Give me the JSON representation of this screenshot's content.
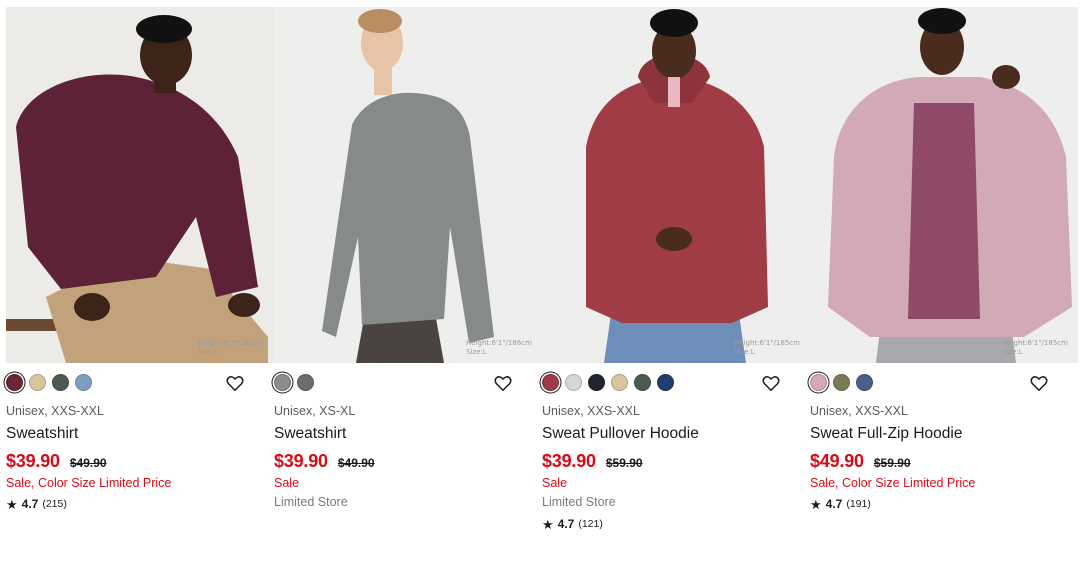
{
  "products": [
    {
      "swatches": [
        "#6b2636",
        "#d8c59f",
        "#4e5a4f",
        "#7f9ec2"
      ],
      "selected_swatch": 0,
      "gender_size": "Unisex, XXS-XXL",
      "name": "Sweatshirt",
      "price": "$39.90",
      "original_price": "$49.90",
      "flag_primary": "Sale, Color Size Limited Price",
      "flag_secondary": "",
      "rating": {
        "star": "★",
        "score": "4.7",
        "count": "(215)"
      },
      "photo": {
        "caption": [
          "Height:6'1\"/185cm",
          "Size:L"
        ],
        "garment_color": "#5d2237",
        "pants_color": "#c2a27a",
        "background": "#ecebe8"
      }
    },
    {
      "swatches": [
        "#8a8c8e",
        "#6b6c6c"
      ],
      "selected_swatch": 0,
      "gender_size": "Unisex, XS-XL",
      "name": "Sweatshirt",
      "price": "$39.90",
      "original_price": "$49.90",
      "flag_primary": "Sale",
      "flag_secondary": "Limited Store",
      "rating": null,
      "photo": {
        "caption": [
          "Height:6'1\"/186cm",
          "Size:L"
        ],
        "garment_color": "#878a8a",
        "pants_color": "#4a4341",
        "background": "#eeeeec"
      }
    },
    {
      "swatches": [
        "#9e3a45",
        "#d6d6d6",
        "#1f2430",
        "#d8c59f",
        "#4e5a4f",
        "#1f3f6e"
      ],
      "selected_swatch": 0,
      "gender_size": "Unisex, XXS-XXL",
      "name": "Sweat Pullover Hoodie",
      "price": "$39.90",
      "original_price": "$59.90",
      "flag_primary": "Sale",
      "flag_secondary": "Limited Store",
      "rating": {
        "star": "★",
        "score": "4.7",
        "count": "(121)"
      },
      "photo": {
        "caption": [
          "Height:6'1\"/185cm",
          "Size:L"
        ],
        "garment_color": "#a03c45",
        "pants_color": "#6f8db9",
        "background": "#eeeeec"
      }
    },
    {
      "swatches": [
        "#d5a9bb",
        "#7b7a58",
        "#4a5f8a"
      ],
      "selected_swatch": 0,
      "gender_size": "Unisex, XXS-XXL",
      "name": "Sweat Full-Zip Hoodie",
      "price": "$49.90",
      "original_price": "$59.90",
      "flag_primary": "Sale, Color Size Limited Price",
      "flag_secondary": "",
      "rating": {
        "star": "★",
        "score": "4.7",
        "count": "(191)"
      },
      "photo": {
        "caption": [
          "Height:6'1\"/185cm",
          "Size:L"
        ],
        "garment_color": "#d2a9b7",
        "pants_color": "#a7a9ad",
        "background": "#eeeeec"
      }
    }
  ],
  "icons": {
    "favorite": "heart-outline-icon",
    "rating": "star-icon"
  }
}
